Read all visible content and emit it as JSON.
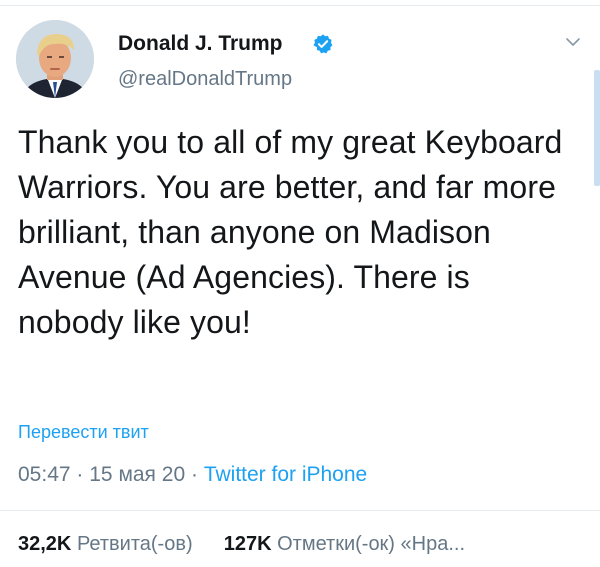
{
  "tweet": {
    "display_name": "Donald J. Trump",
    "handle": "@realDonaldTrump",
    "verified": true,
    "text": "Thank you to all of my great Keyboard Warriors. You are better, and far more brilliant, than anyone on Madison Avenue (Ad Agencies). There is nobody like you!",
    "translate_label": "Перевести твит",
    "time": "05:47",
    "date": "15 мая 20",
    "source": "Twitter for iPhone",
    "separator": "·"
  },
  "stats": {
    "retweets_count": "32,2K",
    "retweets_label": "Ретвита(-ов)",
    "likes_count": "127K",
    "likes_label": "Отметки(-ок) «Нра..."
  },
  "icons": {
    "verified": "verified-badge-icon",
    "menu": "chevron-down-icon"
  },
  "colors": {
    "accent": "#1da1f2",
    "text": "#14171a",
    "secondary": "#657786",
    "divider": "#e6ecf0"
  }
}
